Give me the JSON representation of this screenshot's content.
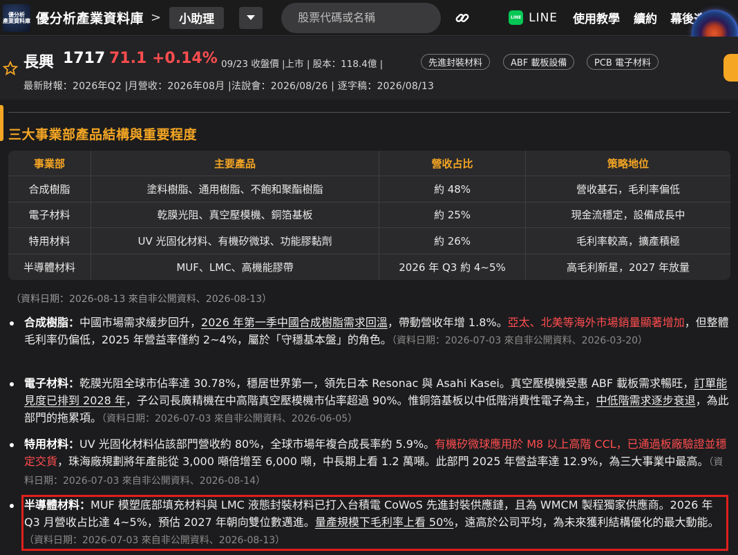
{
  "nav": {
    "logo_text": "優分析\n產業資料庫",
    "site_title": "優分析產業資料庫",
    "breadcrumb_sep": ">",
    "assistant_label": "小助理",
    "search_placeholder": "股票代碼或名稱",
    "line_label": "LINE",
    "tutorial_label": "使用教學",
    "renew_label": "續約",
    "extra_label": "幕後達人"
  },
  "stock": {
    "name": "長興",
    "code": "1717",
    "price": "71.1",
    "change": "+0.14%",
    "meta": "09/23 收盤價 |上市 | 股本：118.4億 |",
    "tags": [
      "先進封裝材料",
      "ABF 載板設備",
      "PCB 電子材料"
    ],
    "sub_meta": "最新財報：2026年Q2 |月營收：2026年08月 |法說會：2026/08/26 | 逐字稿：2026/08/13"
  },
  "section": {
    "title": "三大事業部產品結構與重要程度"
  },
  "table": {
    "headers": [
      "事業部",
      "主要產品",
      "營收占比",
      "策略地位"
    ],
    "rows": [
      [
        "合成樹脂",
        "塗料樹脂、通用樹脂、不飽和聚酯樹脂",
        "約 48%",
        "營收基石，毛利率偏低"
      ],
      [
        "電子材料",
        "乾膜光阻、真空壓模機、銅箔基板",
        "約 25%",
        "現金流穩定，設備成長中"
      ],
      [
        "特用材料",
        "UV 光固化材料、有機矽微球、功能膠黏劑",
        "約 26%",
        "毛利率較高，擴產積極"
      ],
      [
        "半導體材料",
        "MUF、LMC、高機能膠帶",
        "2026 年 Q3 約 4~5%",
        "高毛利新星，2027 年放量"
      ]
    ],
    "source": "（資料日期：2026-08-13 來自非公開資料、2026-08-13）"
  },
  "bullets": [
    {
      "lead": "合成樹脂：",
      "t1": "中國市場需求緩步回升，",
      "u1": "2026 年第一季中國合成樹脂需求回溫",
      "t2": "，帶動營收年增 1.8%。",
      "r1": "亞太、北美等海外市場銷量顯著增加",
      "t3": "，但整體毛利率仍偏低，2025 年營益率僅約 2~4%，屬於「守穩基本盤」的角色。",
      "src": "（資料日期：2026-07-03 來自非公開資料、2026-03-20）"
    },
    {
      "lead": "電子材料：",
      "t1": "乾膜光阻全球市佔率達 30.78%，穩居世界第一，領先日本 Resonac 與 Asahi Kasei。真空壓模機受惠 ABF 載板需求暢旺，",
      "u1": "訂單能見度已排到 2028 年",
      "t2": "，子公司長廣精機在中高階真空壓模機市佔率超過 90%。惟銅箔基板以中低階消費性電子為主，",
      "u2": "中低階需求逐步衰退",
      "t3": "，為此部門的拖累項。",
      "src": "（資料日期：2026-07-03 來自非公開資料、2026-06-05）"
    },
    {
      "lead": "特用材料：",
      "t1": "UV 光固化材料佔該部門營收約 80%，全球市場年複合成長率約 5.9%。",
      "r1": "有機矽微球應用於 M8 以上高階 CCL，已通過板廠驗證並穩定交貨",
      "t2": "，珠海廠規劃將年產能從 3,000 噸倍增至 6,000 噸，中長期上看 1.2 萬噸。此部門 2025 年營益率達 12.9%，為三大事業中最高。",
      "src": "（資料日期：2026-07-03 來自非公開資料、2026-08-14）"
    },
    {
      "lead": "半導體材料：",
      "t1": "MUF 模塑底部填充材料與 LMC 液態封裝材料已打入台積電 CoWoS 先進封裝供應鏈，且為 WMCM 製程獨家供應商。2026 年 Q3 月營收占比達 4~5%，預估 2027 年朝向雙位數邁進。",
      "u1": "量產規模下毛利率上看 50%",
      "t2": "，遠高於公司平均，為未來獲利結構優化的最大動能。",
      "src": "（資料日期：2026-07-03 來自非公開資料、2026-08-13）"
    }
  ],
  "colors": {
    "accent": "#f5a623",
    "price_up": "#ff4d4f",
    "highlight_border": "#e0201c",
    "line_green": "#06c755"
  }
}
